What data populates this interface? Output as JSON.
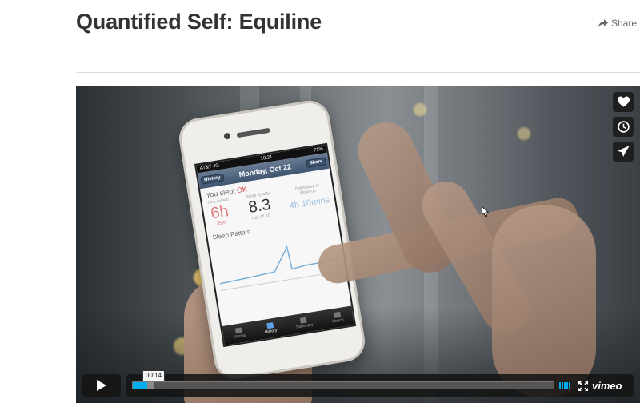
{
  "page": {
    "title": "Quantified Self: Equiline",
    "share_label": "Share"
  },
  "video": {
    "side_actions": [
      "heart-icon",
      "clock-icon",
      "paper-plane-icon"
    ],
    "player": {
      "timecode": "00:14",
      "progress_played": 0.035,
      "progress_loaded": 0.05,
      "brand": "vimeo"
    },
    "phone_screen": {
      "carrier": "AT&T",
      "network": "4G",
      "time": "10:21",
      "battery": "71%",
      "nav_back": "History",
      "nav_title": "Monday, Oct 22",
      "nav_share": "Share",
      "you_slept": "You slept",
      "sleep_status": "OK",
      "metric1_label": "Time Asleep",
      "metric1_value": "6h",
      "metric1_sub": "35m",
      "metric2_label": "Sleep Quality",
      "metric2_value": "8.3",
      "metric2_sub": "out of 10",
      "metric3_label": "Fell Asleep In",
      "metric3_label2": "Woke Up",
      "metric3_value": "4h 10mins",
      "pattern_label": "Sleep Pattern",
      "tabs": [
        "Alarms",
        "History",
        "Summary",
        "Coach"
      ],
      "active_tab": "History"
    }
  },
  "colors": {
    "accent": "#00adef",
    "title": "#333333"
  }
}
